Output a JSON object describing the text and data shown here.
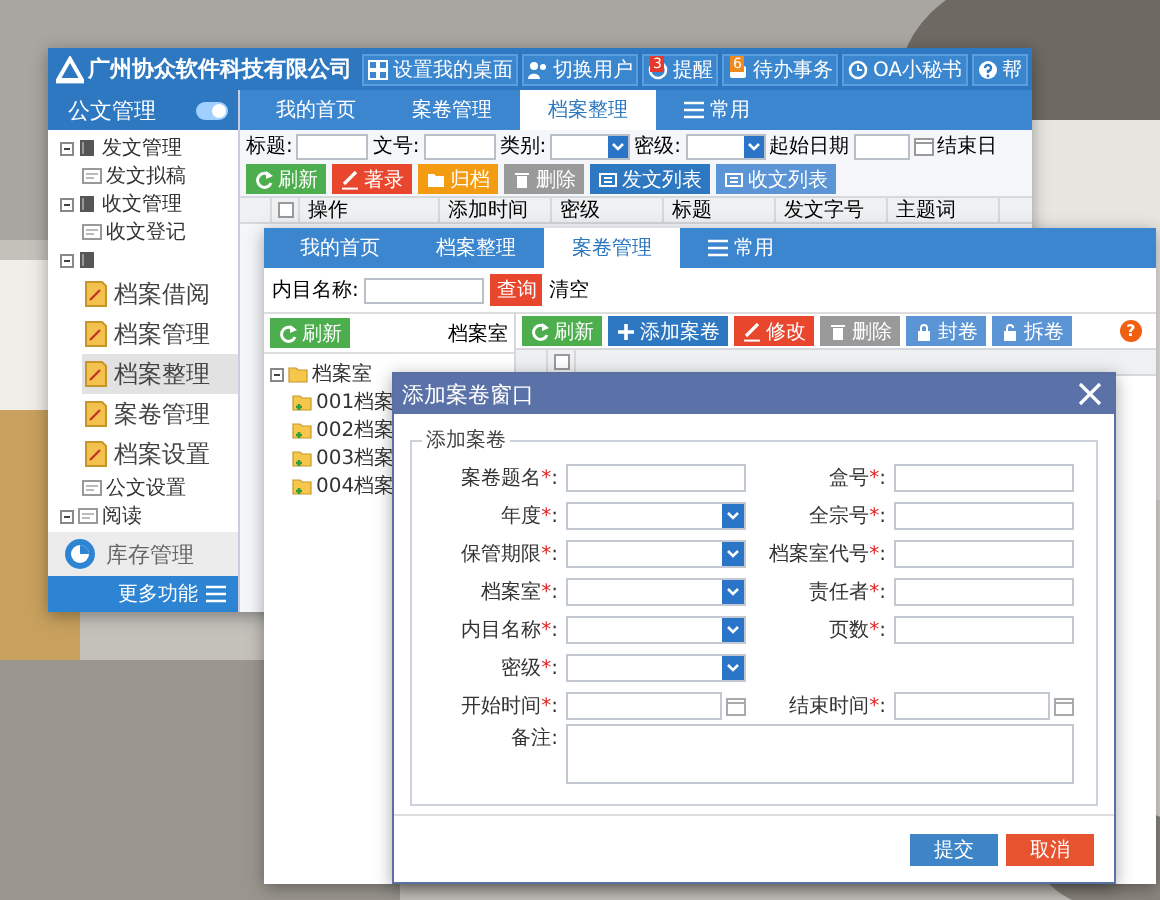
{
  "back_window": {
    "logo": "广州协众软件科技有限公司",
    "header_buttons": [
      {
        "label": "设置我的桌面",
        "kind": "desktop"
      },
      {
        "label": "切换用户",
        "kind": "user"
      },
      {
        "label": "提醒",
        "kind": "clock",
        "badge": {
          "text": "3",
          "color": "#e8382c"
        }
      },
      {
        "label": "待办事务",
        "kind": "task",
        "badge": {
          "text": "6",
          "color": "#f08a1c"
        }
      },
      {
        "label": "OA小秘书",
        "kind": "clock"
      },
      {
        "label": "帮",
        "kind": "help"
      }
    ],
    "sidebar": {
      "title": "公文管理",
      "toggle_on": true,
      "tree": [
        {
          "label": "发文管理",
          "expanded": true,
          "selected": false,
          "children": [
            {
              "label": "发文拟稿",
              "selected": false
            }
          ]
        },
        {
          "label": "收文管理",
          "expanded": true,
          "selected": false,
          "children": [
            {
              "label": "收文登记",
              "selected": false
            }
          ]
        },
        {
          "expanded": true,
          "selected": false,
          "children": [
            {
              "label": "档案借阅",
              "kind": "module",
              "selected": false
            },
            {
              "label": "档案管理",
              "kind": "module",
              "selected": false
            },
            {
              "label": "档案整理",
              "kind": "module",
              "selected": true
            },
            {
              "label": "案卷管理",
              "kind": "module",
              "selected": false
            },
            {
              "label": "档案设置",
              "kind": "module",
              "selected": false
            },
            {
              "label": "公文设置",
              "selected": false
            }
          ]
        },
        {
          "label": "阅读",
          "expanded": true,
          "selected": false
        }
      ],
      "module": "库存管理",
      "more": "更多功能"
    },
    "tabs": [
      {
        "label": "我的首页",
        "selected": false,
        "kind": "page"
      },
      {
        "label": "案卷管理",
        "selected": false,
        "kind": "page"
      },
      {
        "label": "档案整理",
        "selected": true,
        "kind": "page"
      },
      {
        "label": "常用",
        "selected": false,
        "kind": "menu"
      }
    ],
    "filters": [
      {
        "label": "标题:",
        "kind": "text"
      },
      {
        "label": "文号:",
        "kind": "text"
      },
      {
        "label": "类别:",
        "kind": "select"
      },
      {
        "label": "密级:",
        "kind": "select"
      },
      {
        "label": "起始日期",
        "kind": "date"
      },
      {
        "label": "结束日",
        "kind": "cut"
      }
    ],
    "toolbar": [
      {
        "label": "刷新",
        "kind": "refresh",
        "color": "#4cae4c"
      },
      {
        "label": "著录",
        "kind": "edit",
        "color": "#e8472e"
      },
      {
        "label": "归档",
        "kind": "folder",
        "color": "#f39c12"
      },
      {
        "label": "删除",
        "kind": "delete",
        "color": "#9a9a9a"
      },
      {
        "label": "发文列表",
        "kind": "list",
        "color": "#2d78c0"
      },
      {
        "label": "收文列表",
        "kind": "list",
        "color": "#5b95d6"
      }
    ],
    "select_all_checked": false,
    "columns": [
      "操作",
      "添加时间",
      "密级",
      "标题",
      "发文字号",
      "主题词"
    ]
  },
  "middle_window": {
    "tabs": [
      {
        "label": "我的首页",
        "selected": false,
        "kind": "page"
      },
      {
        "label": "档案整理",
        "selected": false,
        "kind": "page"
      },
      {
        "label": "案卷管理",
        "selected": true,
        "kind": "page"
      },
      {
        "label": "常用",
        "selected": false,
        "kind": "menu"
      }
    ],
    "search": {
      "label": "内目名称:",
      "query_button": "查询",
      "clear": "清空"
    },
    "left_pane": {
      "refresh": "刷新",
      "title": "档案室",
      "tree": [
        {
          "label": "档案室",
          "expanded": true,
          "selected": false,
          "children": [
            {
              "label": "001档案",
              "selected": false
            },
            {
              "label": "002档案",
              "selected": false
            },
            {
              "label": "003档案",
              "selected": false
            },
            {
              "label": "004档案",
              "selected": false
            }
          ]
        }
      ]
    },
    "toolbar": [
      {
        "label": "刷新",
        "kind": "refresh",
        "color": "#4cae4c"
      },
      {
        "label": "添加案卷",
        "kind": "add",
        "color": "#2d78c0"
      },
      {
        "label": "修改",
        "kind": "edit",
        "color": "#e8472e"
      },
      {
        "label": "删除",
        "kind": "delete",
        "color": "#9a9a9a"
      },
      {
        "label": "封卷",
        "kind": "lock",
        "color": "#5b95d6"
      },
      {
        "label": "拆卷",
        "kind": "unlock",
        "color": "#5b95d6"
      }
    ],
    "help": "?",
    "select_all_checked": false
  },
  "dialog": {
    "title": "添加案卷窗口",
    "legend": "添加案卷",
    "rows": [
      [
        {
          "label": "案卷题名",
          "asterisk": "*",
          "colon": ":",
          "kind": "text"
        },
        {
          "label": "盒号",
          "asterisk": "*",
          "colon": ":",
          "kind": "text"
        }
      ],
      [
        {
          "label": "年度",
          "asterisk": "*",
          "colon": ":",
          "kind": "select"
        },
        {
          "label": "全宗号",
          "asterisk": "*",
          "colon": ":",
          "kind": "text"
        }
      ],
      [
        {
          "label": "保管期限",
          "asterisk": "*",
          "colon": ":",
          "kind": "select"
        },
        {
          "label": "档案室代号",
          "asterisk": "*",
          "colon": ":",
          "kind": "text"
        }
      ],
      [
        {
          "label": "档案室",
          "asterisk": "*",
          "colon": ":",
          "kind": "select"
        },
        {
          "label": "责任者",
          "asterisk": "*",
          "colon": ":",
          "kind": "text"
        }
      ],
      [
        {
          "label": "内目名称",
          "asterisk": "*",
          "colon": ":",
          "kind": "select"
        },
        {
          "label": "页数",
          "asterisk": "*",
          "colon": ":",
          "kind": "text"
        }
      ],
      [
        {
          "label": "密级",
          "asterisk": "*",
          "colon": ":",
          "kind": "select"
        }
      ],
      [
        {
          "label": "开始时间",
          "asterisk": "*",
          "colon": ":",
          "kind": "date"
        },
        {
          "label": "结束时间",
          "asterisk": "*",
          "colon": ":",
          "kind": "date"
        }
      ],
      [
        {
          "label": "备注",
          "colon": ":",
          "kind": "textarea"
        }
      ]
    ],
    "buttons": [
      {
        "label": "提交",
        "color": "#3d85c6"
      },
      {
        "label": "取消",
        "color": "#e8532f"
      }
    ]
  }
}
